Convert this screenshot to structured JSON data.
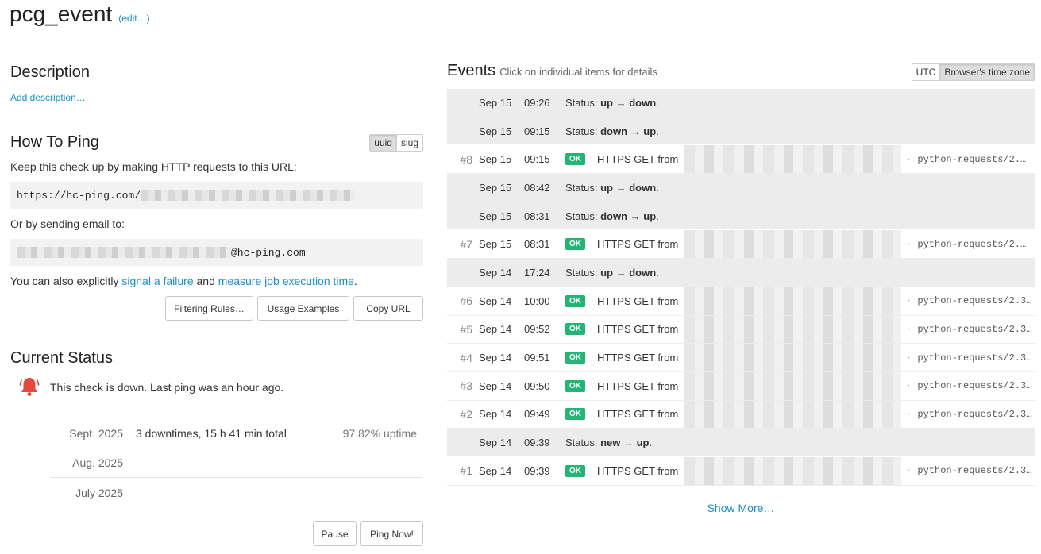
{
  "header": {
    "title": "pcg_event",
    "edit_label": "(edit…)"
  },
  "description": {
    "heading": "Description",
    "add_label": "Add description…"
  },
  "how_to_ping": {
    "heading": "How To Ping",
    "kind_options": [
      "uuid",
      "slug"
    ],
    "kind_selected": "uuid",
    "url_intro": "Keep this check up by making HTTP requests to this URL:",
    "url_prefix": "https://hc-ping.com/",
    "email_intro": "Or by sending email to:",
    "email_suffix": "@hc-ping.com",
    "explicit_text_1": "You can also explicitly ",
    "signal_failure_link": "signal a failure",
    "explicit_text_2": " and ",
    "measure_link": "measure job execution time",
    "explicit_text_3": ".",
    "buttons": {
      "filtering": "Filtering Rules…",
      "usage": "Usage Examples",
      "copy": "Copy URL"
    }
  },
  "current_status": {
    "heading": "Current Status",
    "message": "This check is down. Last ping was an hour ago.",
    "status_color": "#e8473b",
    "downtimes": [
      {
        "month": "Sept. 2025",
        "info": "3 downtimes, 15 h 41 min total",
        "uptime": "97.82% uptime"
      },
      {
        "month": "Aug. 2025",
        "info": "–",
        "uptime": ""
      },
      {
        "month": "July 2025",
        "info": "–",
        "uptime": ""
      }
    ],
    "buttons": {
      "pause": "Pause",
      "ping_now": "Ping Now!"
    }
  },
  "events": {
    "heading": "Events",
    "hint": "Click on individual items for details",
    "tz_options": [
      "UTC",
      "Browser's time zone"
    ],
    "tz_selected": "Browser's time zone",
    "show_more": "Show More…",
    "ok_badge_color": "#22b573",
    "rows": [
      {
        "kind": "flip",
        "date": "Sep 15",
        "time": "09:26",
        "status_prefix": "Status: ",
        "from": "up",
        "to": "down"
      },
      {
        "kind": "flip",
        "date": "Sep 15",
        "time": "09:15",
        "status_prefix": "Status: ",
        "from": "down",
        "to": "up"
      },
      {
        "kind": "ping",
        "num": "#8",
        "date": "Sep 15",
        "time": "09:15",
        "badge": "OK",
        "desc": "HTTPS GET from",
        "ua": "python-requests/2.…"
      },
      {
        "kind": "flip",
        "date": "Sep 15",
        "time": "08:42",
        "status_prefix": "Status: ",
        "from": "up",
        "to": "down"
      },
      {
        "kind": "flip",
        "date": "Sep 15",
        "time": "08:31",
        "status_prefix": "Status: ",
        "from": "down",
        "to": "up"
      },
      {
        "kind": "ping",
        "num": "#7",
        "date": "Sep 15",
        "time": "08:31",
        "badge": "OK",
        "desc": "HTTPS GET from",
        "ua": "python-requests/2.…"
      },
      {
        "kind": "flip",
        "date": "Sep 14",
        "time": "17:24",
        "status_prefix": "Status: ",
        "from": "up",
        "to": "down"
      },
      {
        "kind": "ping",
        "num": "#6",
        "date": "Sep 14",
        "time": "10:00",
        "badge": "OK",
        "desc": "HTTPS GET from",
        "ua": "python-requests/2.3…"
      },
      {
        "kind": "ping",
        "num": "#5",
        "date": "Sep 14",
        "time": "09:52",
        "badge": "OK",
        "desc": "HTTPS GET from",
        "ua": "python-requests/2.3…"
      },
      {
        "kind": "ping",
        "num": "#4",
        "date": "Sep 14",
        "time": "09:51",
        "badge": "OK",
        "desc": "HTTPS GET from",
        "ua": "python-requests/2.3…"
      },
      {
        "kind": "ping",
        "num": "#3",
        "date": "Sep 14",
        "time": "09:50",
        "badge": "OK",
        "desc": "HTTPS GET from",
        "ua": "python-requests/2.3…"
      },
      {
        "kind": "ping",
        "num": "#2",
        "date": "Sep 14",
        "time": "09:49",
        "badge": "OK",
        "desc": "HTTPS GET from",
        "ua": "python-requests/2.3…"
      },
      {
        "kind": "flip",
        "date": "Sep 14",
        "time": "09:39",
        "status_prefix": "Status: ",
        "from": "new",
        "to": "up"
      },
      {
        "kind": "ping",
        "num": "#1",
        "date": "Sep 14",
        "time": "09:39",
        "badge": "OK",
        "desc": "HTTPS GET from",
        "ua": "python-requests/2.3…"
      }
    ]
  }
}
